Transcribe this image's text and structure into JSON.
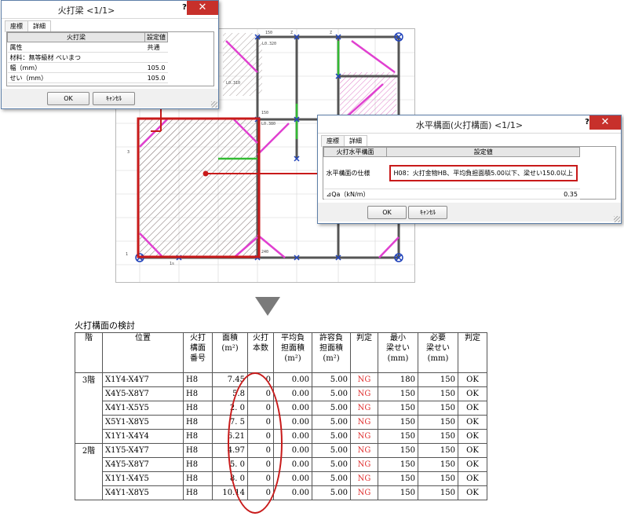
{
  "dialog_beam": {
    "title": "火打梁 <1/1>",
    "help": "?",
    "close": "✕",
    "tabs": [
      "座標",
      "詳細"
    ],
    "header": [
      "火打梁",
      "設定値"
    ],
    "rows": [
      {
        "label": "属性",
        "value": "共通"
      },
      {
        "label": "材料：無等級材 べいまつ",
        "value": ""
      },
      {
        "label": "幅（mm）",
        "value": "105.0"
      },
      {
        "label": "せい（mm）",
        "value": "105.0"
      }
    ],
    "ok": "OK",
    "cancel": "ｷｬﾝｾﾙ"
  },
  "dialog_plane": {
    "title": "水平構面(火打構面) <1/1>",
    "help": "?",
    "close": "✕",
    "tabs": [
      "座標",
      "詳細"
    ],
    "header": [
      "火打水平構面",
      "設定値"
    ],
    "spec_label": "水平構面の仕様",
    "spec_value": "H08：火打金物HB、平均負担面積5.00以下、梁せい150.0以上",
    "qa_label": "⊿Qa（kN/m）",
    "qa_value": "0.35",
    "ok": "OK",
    "cancel": "ｷｬﾝｾﾙ"
  },
  "plan_labels": [
    "150",
    "Z",
    "S",
    "Z",
    "Z",
    "L0.320",
    "L0.310",
    "L0.310",
    "b",
    "150",
    "Z",
    "L0.380",
    "L0.900",
    "L0.900",
    "L0.100",
    "240",
    "Z",
    "Z",
    "1s",
    "4",
    "1",
    "3",
    "T",
    "T",
    "T",
    "L",
    "L"
  ],
  "table": {
    "title": "火打構面の検討",
    "headers": [
      "階",
      "位置",
      "火打\n構面\n番号",
      "面積\n(m²)",
      "火打\n本数",
      "平均負\n担面積\n(m²)",
      "許容負\n担面積\n(m²)",
      "判定",
      "最小\n梁せい\n(mm)",
      "必要\n梁せい\n(mm)",
      "判定"
    ],
    "rows": [
      {
        "floor": "3階",
        "pos": "X1Y4-X4Y7",
        "no": "H8",
        "area": "7.45",
        "count": "0",
        "avg": "0.00",
        "allow": "5.00",
        "judge1": "NG",
        "min": "180",
        "need": "150",
        "judge2": "OK"
      },
      {
        "floor": "",
        "pos": "X4Y5-X8Y7",
        "no": "H8",
        "area": "5.8",
        "count": "0",
        "avg": "0.00",
        "allow": "5.00",
        "judge1": "NG",
        "min": "150",
        "need": "150",
        "judge2": "OK"
      },
      {
        "floor": "",
        "pos": "X4Y1-X5Y5",
        "no": "H8",
        "area": "2. 0",
        "count": "0",
        "avg": "0.00",
        "allow": "5.00",
        "judge1": "NG",
        "min": "150",
        "need": "150",
        "judge2": "OK"
      },
      {
        "floor": "",
        "pos": "X5Y1-X8Y5",
        "no": "H8",
        "area": "7. 5",
        "count": "0",
        "avg": "0.00",
        "allow": "5.00",
        "judge1": "NG",
        "min": "150",
        "need": "150",
        "judge2": "OK"
      },
      {
        "floor": "",
        "pos": "X1Y1-X4Y4",
        "no": "H8",
        "area": "6.21",
        "count": "0",
        "avg": "0.00",
        "allow": "5.00",
        "judge1": "NG",
        "min": "150",
        "need": "150",
        "judge2": "OK"
      },
      {
        "floor": "2階",
        "pos": "X1Y5-X4Y7",
        "no": "H8",
        "area": "4.97",
        "count": "0",
        "avg": "0.00",
        "allow": "5.00",
        "judge1": "NG",
        "min": "150",
        "need": "150",
        "judge2": "OK"
      },
      {
        "floor": "",
        "pos": "X4Y5-X8Y7",
        "no": "H8",
        "area": "5. 0",
        "count": "0",
        "avg": "0.00",
        "allow": "5.00",
        "judge1": "NG",
        "min": "150",
        "need": "150",
        "judge2": "OK"
      },
      {
        "floor": "",
        "pos": "X1Y1-X4Y5",
        "no": "H8",
        "area": "8. 0",
        "count": "0",
        "avg": "0.00",
        "allow": "5.00",
        "judge1": "NG",
        "min": "150",
        "need": "150",
        "judge2": "OK"
      },
      {
        "floor": "",
        "pos": "X4Y1-X8Y5",
        "no": "H8",
        "area": "10.14",
        "count": "0",
        "avg": "0.00",
        "allow": "5.00",
        "judge1": "NG",
        "min": "150",
        "need": "150",
        "judge2": "OK"
      }
    ]
  },
  "colors": {
    "highlight_red": "#c81a1a",
    "brace_magenta": "#e040d0",
    "beam_green": "#33bb33",
    "node_blue": "#2244bb"
  }
}
